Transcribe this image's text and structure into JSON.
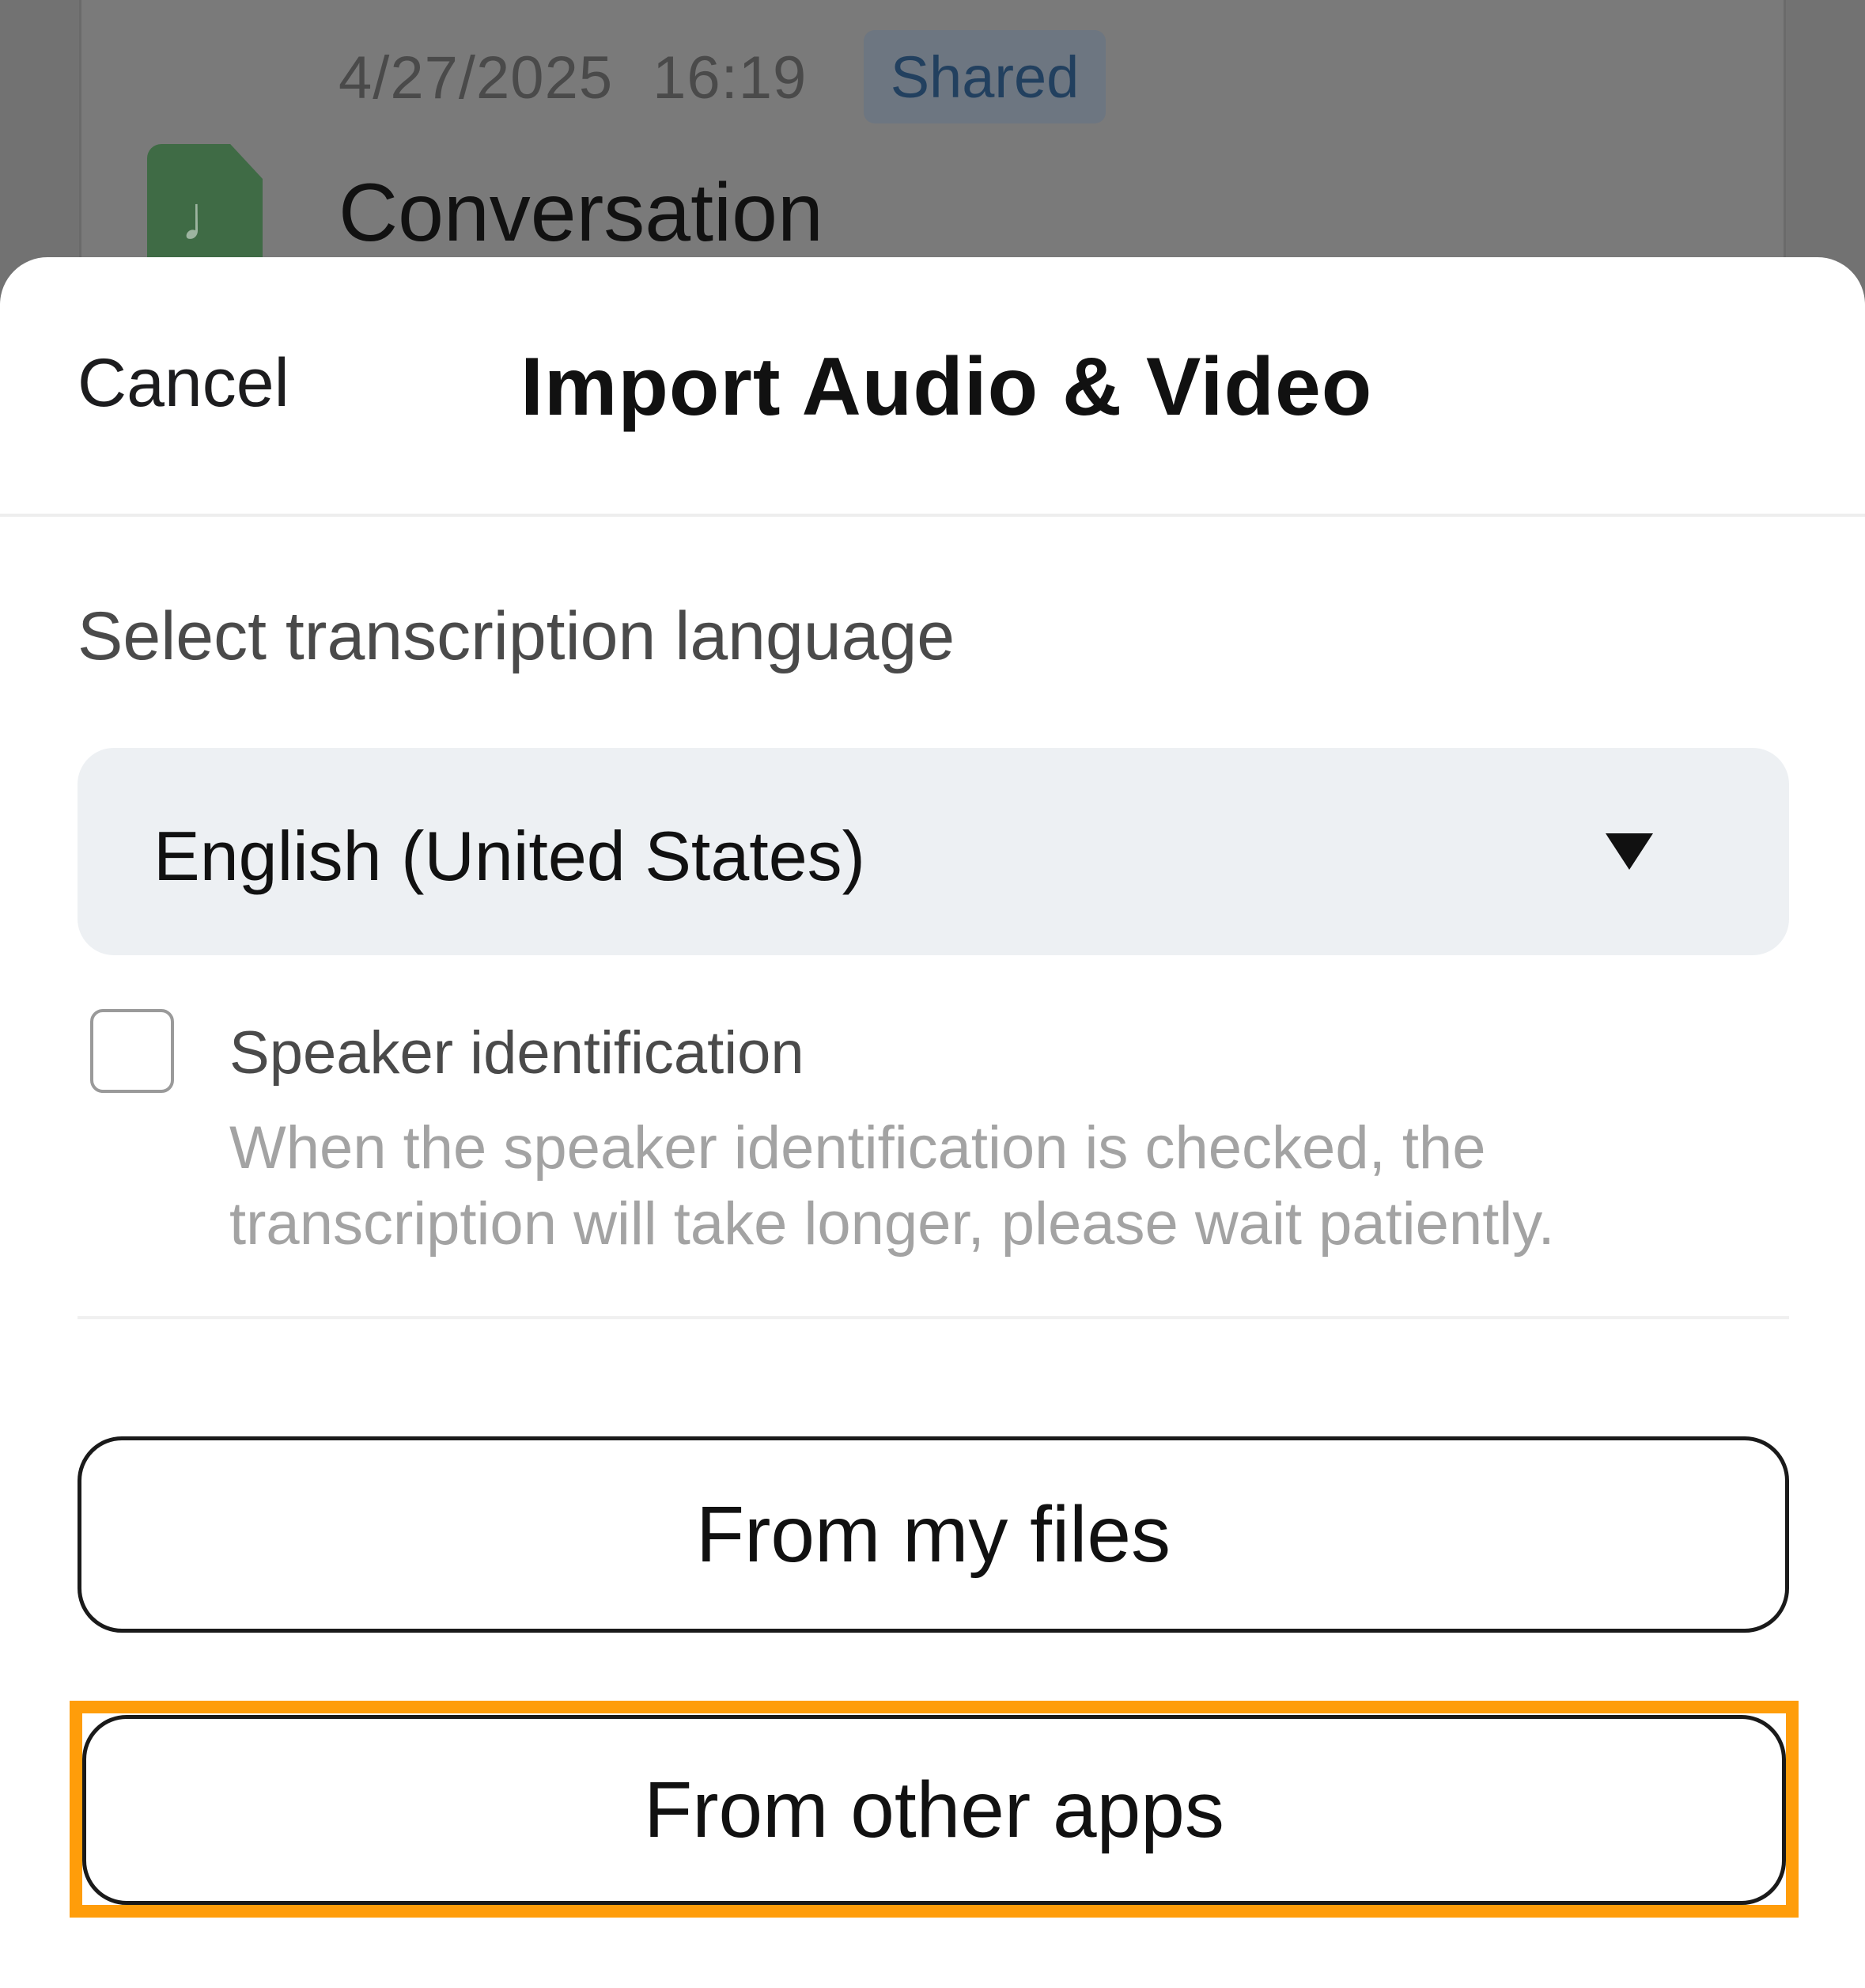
{
  "background": {
    "date": "4/27/2025",
    "time": "16:19",
    "badge": "Shared",
    "file_icon": "music-note-icon",
    "item_title": "Conversation"
  },
  "sheet": {
    "cancel_label": "Cancel",
    "title": "Import Audio & Video",
    "language_label": "Select transcription language",
    "language_value": "English (United States)",
    "dropdown_icon": "caret-down-icon",
    "speaker_checkbox_label": "Speaker identification",
    "speaker_checked": false,
    "speaker_hint": "When the speaker identification is checked, the transcription will take longer, please wait patiently.",
    "from_files_label": "From my files",
    "from_apps_label": "From other apps"
  },
  "colors": {
    "highlight": "#ff9d0a",
    "select_bg": "#edf0f3",
    "file_icon": "#3f6b45"
  }
}
